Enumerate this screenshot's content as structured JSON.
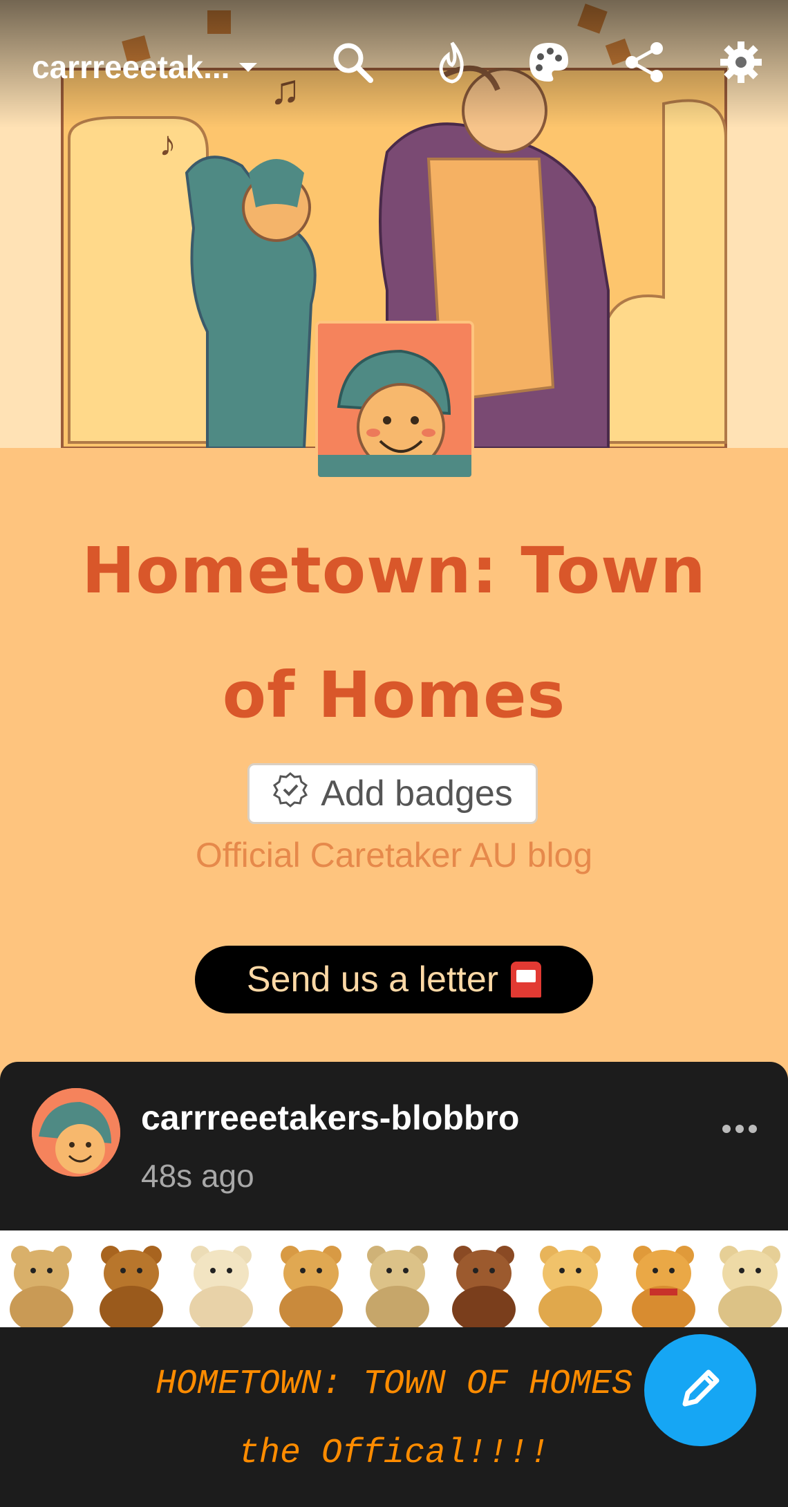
{
  "header": {
    "blog_name": "carrreeetak...",
    "icons": [
      "search-icon",
      "fire-icon",
      "palette-icon",
      "share-icon",
      "gear-icon"
    ]
  },
  "profile": {
    "title_line1": "Hometown: Town",
    "title_line2": "of Homes",
    "add_badges_label": "Add badges",
    "description": "Official Caretaker AU blog",
    "letter_button_label": "Send us a letter"
  },
  "post": {
    "username": "carrreeetakers-blobbro",
    "timestamp": "48s ago",
    "line1": "HOMETOWN: TOWN OF HOMES",
    "line2": "the Offical!!!!"
  },
  "colors": {
    "page_bg": "#fec47e",
    "title": "#d9572a",
    "description": "#e6894b",
    "post_bg": "#1c1c1c",
    "post_text": "#ff8c00",
    "fab": "#16a6f4"
  }
}
